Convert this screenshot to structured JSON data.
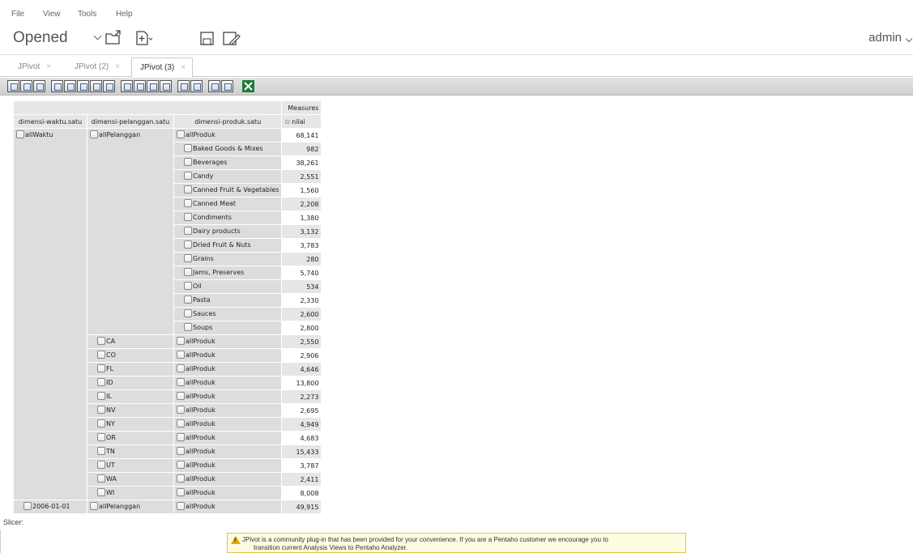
{
  "menu": [
    "File",
    "View",
    "Tools",
    "Help"
  ],
  "perspective": {
    "label": "Opened",
    "user": "admin"
  },
  "tabs": [
    "JPivot",
    "JPivot (2)",
    "JPivot (3)"
  ],
  "tab_close": "×",
  "toolbar_icons": [
    "cube-navigator-icon",
    "mdx-editor-icon",
    "sort-options-icon",
    "show-parents-icon",
    "hide-spans-icon",
    "show-properties-icon",
    "suppress-empty-icon",
    "swap-axes-icon",
    "drill-member-icon",
    "drill-position-icon",
    "drill-replace-icon",
    "drill-through-icon",
    "show-chart-icon",
    "chart-config-icon",
    "print-config-icon",
    "print-pdf-icon",
    "export-excel-icon"
  ],
  "pivot": {
    "measures_header": "Measures",
    "col_headers": [
      "dimensi-waktu.satu",
      "dimensi-pelanggan.satu",
      "dimensi-produk.satu"
    ],
    "measure_name": "nilai",
    "sort_symbol": "⊙",
    "waktu_all": "allWaktu",
    "pelanggan_all": "allPelanggan",
    "produk_all": "allProduk",
    "total": "68,141",
    "products": [
      {
        "name": "Baked Goods & Mixes",
        "value": "982"
      },
      {
        "name": "Beverages",
        "value": "38,261"
      },
      {
        "name": "Candy",
        "value": "2,551"
      },
      {
        "name": "Canned Fruit & Vegetables",
        "value": "1,560"
      },
      {
        "name": "Canned Meat",
        "value": "2,208"
      },
      {
        "name": "Condiments",
        "value": "1,380"
      },
      {
        "name": "Dairy products",
        "value": "3,132"
      },
      {
        "name": "Dried Fruit & Nuts",
        "value": "3,783"
      },
      {
        "name": "Grains",
        "value": "280"
      },
      {
        "name": "Jams, Preserves",
        "value": "5,740"
      },
      {
        "name": "Oil",
        "value": "534"
      },
      {
        "name": "Pasta",
        "value": "2,330"
      },
      {
        "name": "Sauces",
        "value": "2,600"
      },
      {
        "name": "Soups",
        "value": "2,800"
      }
    ],
    "states": [
      {
        "name": "CA",
        "produk": "allProduk",
        "value": "2,550"
      },
      {
        "name": "CO",
        "produk": "allProduk",
        "value": "2,906"
      },
      {
        "name": "FL",
        "produk": "allProduk",
        "value": "4,646"
      },
      {
        "name": "ID",
        "produk": "allProduk",
        "value": "13,800"
      },
      {
        "name": "IL",
        "produk": "allProduk",
        "value": "2,273"
      },
      {
        "name": "NV",
        "produk": "allProduk",
        "value": "2,695"
      },
      {
        "name": "NY",
        "produk": "allProduk",
        "value": "4,949"
      },
      {
        "name": "OR",
        "produk": "allProduk",
        "value": "4,683"
      },
      {
        "name": "TN",
        "produk": "allProduk",
        "value": "15,433"
      },
      {
        "name": "UT",
        "produk": "allProduk",
        "value": "3,787"
      },
      {
        "name": "WA",
        "produk": "allProduk",
        "value": "2,411"
      },
      {
        "name": "WI",
        "produk": "allProduk",
        "value": "8,008"
      }
    ],
    "last_row": {
      "waktu": "2006-01-01",
      "pelanggan": "allPelanggan",
      "produk": "allProduk",
      "value": "49,915"
    }
  },
  "slicer_label": "Slicer:",
  "warning": {
    "line1": "JPivot is a community plug-in that has been provided for your convenience. If you are a Pentaho customer we encourage you to",
    "line2": "transition current Analysis Views to Pentaho Analyzer."
  }
}
